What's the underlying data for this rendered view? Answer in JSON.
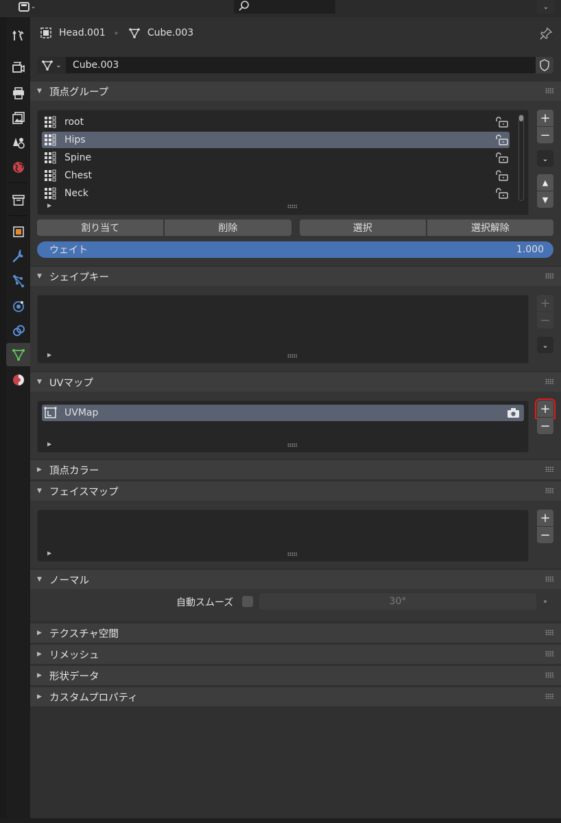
{
  "header": {
    "breadcrumb": {
      "object": "Head.001",
      "mesh": "Cube.003"
    }
  },
  "mesh_selector": {
    "name": "Cube.003"
  },
  "panels": {
    "vertex_groups": {
      "title": "頂点グループ",
      "items": [
        {
          "name": "root",
          "selected": false
        },
        {
          "name": "Hips",
          "selected": true
        },
        {
          "name": "Spine",
          "selected": false
        },
        {
          "name": "Chest",
          "selected": false
        },
        {
          "name": "Neck",
          "selected": false
        }
      ],
      "buttons": {
        "assign": "割り当て",
        "remove": "削除",
        "select": "選択",
        "deselect": "選択解除"
      },
      "weight": {
        "label": "ウェイト",
        "value": "1.000"
      }
    },
    "shape_keys": {
      "title": "シェイプキー"
    },
    "uv_maps": {
      "title": "UVマップ",
      "items": [
        {
          "name": "UVMap"
        }
      ]
    },
    "vertex_colors": {
      "title": "頂点カラー"
    },
    "face_maps": {
      "title": "フェイスマップ"
    },
    "normals": {
      "title": "ノーマル",
      "auto_smooth_label": "自動スムーズ",
      "angle": "30°"
    },
    "texture_space": {
      "title": "テクスチャ空間"
    },
    "remesh": {
      "title": "リメッシュ"
    },
    "geometry_data": {
      "title": "形状データ"
    },
    "custom_properties": {
      "title": "カスタムプロパティ"
    }
  },
  "tabs": [
    "tool-tab",
    "render-tab",
    "output-tab",
    "view-layer-tab",
    "scene-tab",
    "world-tab",
    "collection-tab",
    "object-tab",
    "modifiers-tab",
    "particles-tab",
    "physics-tab",
    "constraints-tab",
    "data-tab",
    "material-tab"
  ],
  "active_tab": "data-tab",
  "colors": {
    "accent": "#4772b3",
    "selection": "#5a6171",
    "highlight_box": "#e31b1b",
    "data_icon": "#5fc35a"
  }
}
